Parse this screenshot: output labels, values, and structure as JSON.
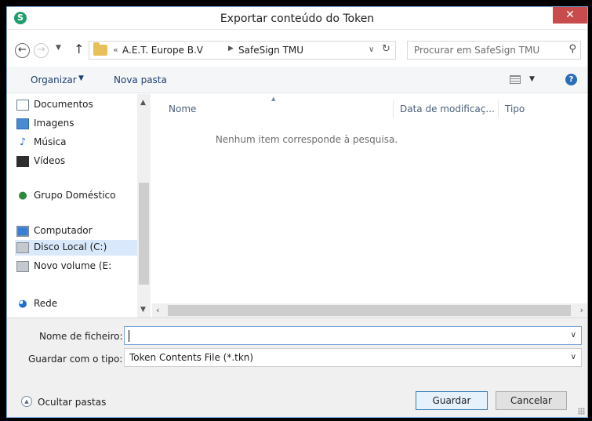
{
  "window": {
    "title": "Exportar conteúdo do Token",
    "app_icon_glyph": "S",
    "close_glyph": "✕"
  },
  "address": {
    "breadcrumb_prefix": "«",
    "breadcrumb": [
      "A.E.T. Europe B.V",
      "SafeSign TMU"
    ],
    "search_placeholder": "Procurar em SafeSign TMU"
  },
  "toolbar": {
    "organize_label": "Organizar",
    "new_folder_label": "Nova pasta"
  },
  "nav_pane": {
    "items": [
      {
        "label": "Documentos",
        "icon": "documents-icon"
      },
      {
        "label": "Imagens",
        "icon": "pictures-icon"
      },
      {
        "label": "Música",
        "icon": "music-icon"
      },
      {
        "label": "Vídeos",
        "icon": "videos-icon"
      },
      {
        "label": "Grupo Doméstico",
        "icon": "homegroup-icon"
      },
      {
        "label": "Computador",
        "icon": "computer-icon"
      },
      {
        "label": "Disco Local (C:)",
        "icon": "local-disk-icon",
        "selected": true
      },
      {
        "label": "Novo volume (E:",
        "icon": "drive-icon"
      },
      {
        "label": "Rede",
        "icon": "network-icon"
      }
    ]
  },
  "file_list": {
    "columns": [
      "Nome",
      "Data de modificaç...",
      "Tipo"
    ],
    "empty_message": "Nenhum item corresponde à pesquisa."
  },
  "save_form": {
    "filename_label": "Nome de ficheiro:",
    "filename_value": "",
    "filetype_label": "Guardar com o tipo:",
    "filetype_value": "Token Contents File (*.tkn)"
  },
  "footer": {
    "hide_folders_label": "Ocultar pastas",
    "save_button": "Guardar",
    "cancel_button": "Cancelar"
  },
  "colors": {
    "close_button": "#c74c4b",
    "selection": "#d9e8fb",
    "link_text": "#1e3f73",
    "window_border": "#7aa4d6"
  }
}
